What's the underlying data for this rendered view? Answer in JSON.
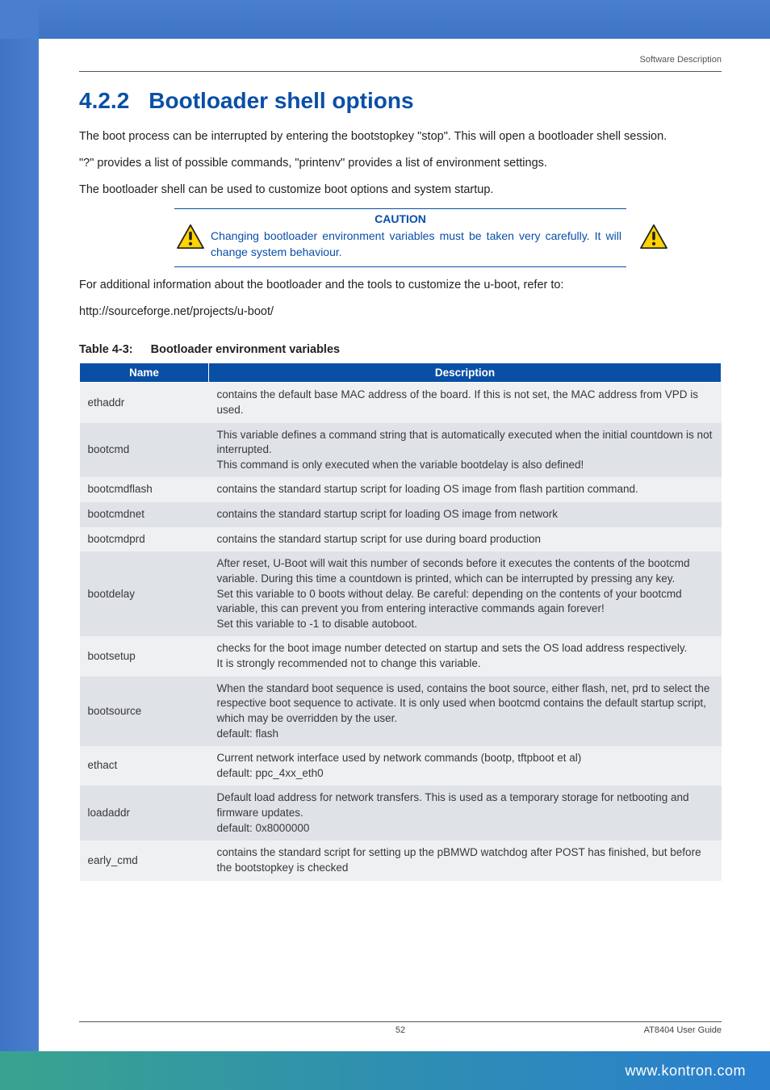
{
  "header": {
    "section_label": "Software Description"
  },
  "heading": {
    "number": "4.2.2",
    "title": "Bootloader shell options"
  },
  "paragraphs": {
    "p1": "The boot process can be interrupted by entering the bootstopkey \"stop\". This will open a bootloader shell session.",
    "p2": "\"?\" provides a list of possible commands, \"printenv\" provides a list of environment settings.",
    "p3": "The bootloader shell can be used to customize boot options and system startup.",
    "p4": "For additional information about the bootloader and the tools to customize the u-boot, refer to:",
    "p5": "http://sourceforge.net/projects/u-boot/"
  },
  "caution": {
    "title": "CAUTION",
    "body": "Changing bootloader environment variables must be taken very carefully. It will change system behaviour."
  },
  "table": {
    "caption_number": "Table 4-3:",
    "caption_title": "Bootloader environment variables",
    "headers": {
      "name": "Name",
      "desc": "Description"
    },
    "rows": [
      {
        "name": "ethaddr",
        "desc": "contains the default base MAC address of the board. If this is not set, the MAC address from VPD is used."
      },
      {
        "name": "bootcmd",
        "desc": "This variable defines a command string that is automatically executed when the initial countdown is not interrupted.\nThis command is only executed when the variable bootdelay is also defined!"
      },
      {
        "name": "bootcmdflash",
        "desc": "contains the standard startup script for loading OS image from flash partition command."
      },
      {
        "name": "bootcmdnet",
        "desc": "contains the standard startup script for loading OS image from network"
      },
      {
        "name": "bootcmdprd",
        "desc": "contains the standard startup script for use during board production"
      },
      {
        "name": "bootdelay",
        "desc": "After reset, U-Boot will wait this number of seconds before it executes the contents of the bootcmd variable. During this time a countdown is printed, which can be interrupted by pressing any key.\nSet this variable to 0 boots without delay. Be careful: depending on the contents of your bootcmd variable, this can prevent you from entering interactive commands again forever!\nSet this variable to -1 to disable autoboot."
      },
      {
        "name": "bootsetup",
        "desc": "checks for the boot image number detected on startup and sets the OS load address respectively.\nIt is strongly recommended not to change this variable."
      },
      {
        "name": "bootsource",
        "desc": "When the standard boot sequence is used, contains the boot source, either flash, net, prd to select the respective boot sequence to activate. It is only used when bootcmd contains the default startup script, which may be overridden by the user.\ndefault: flash"
      },
      {
        "name": "ethact",
        "desc": "Current network interface used by network commands (bootp, tftpboot et al)\ndefault: ppc_4xx_eth0"
      },
      {
        "name": "loadaddr",
        "desc": "Default load address for network transfers. This is used as a temporary storage for netbooting and firmware updates.\ndefault: 0x8000000"
      },
      {
        "name": "early_cmd",
        "desc": "contains the standard script for setting up the pBMWD watchdog after POST has finished, but before the bootstopkey is checked"
      }
    ]
  },
  "footer": {
    "page_number": "52",
    "guide": "AT8404 User Guide",
    "url": "www.kontron.com"
  }
}
